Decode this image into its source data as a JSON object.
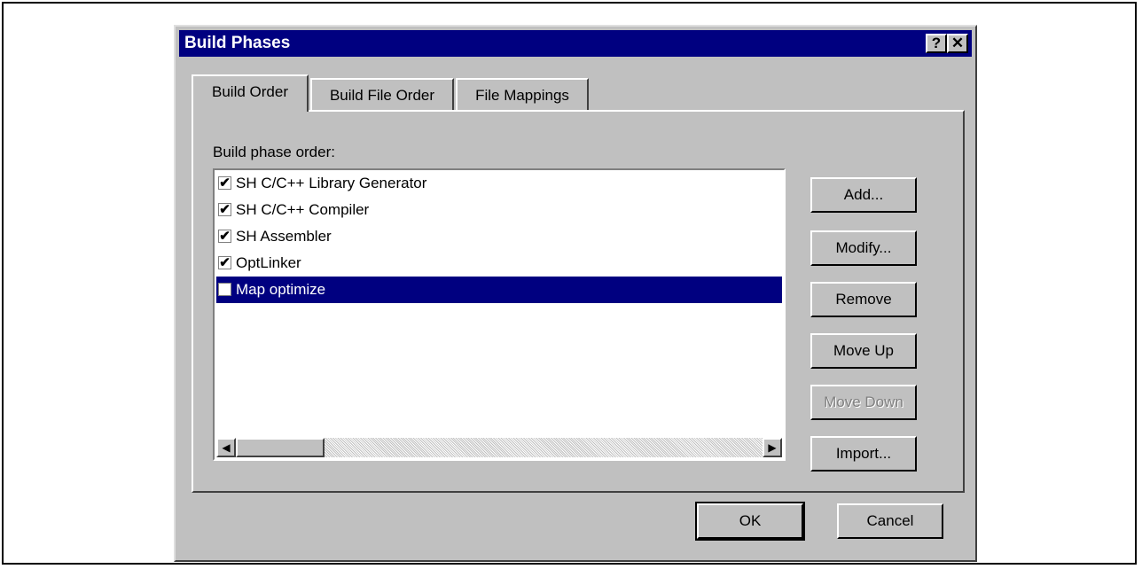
{
  "dialog": {
    "title": "Build Phases",
    "help_label": "?",
    "close_label": "✕"
  },
  "tabs": [
    {
      "label": "Build Order",
      "active": true
    },
    {
      "label": "Build File Order",
      "active": false
    },
    {
      "label": "File Mappings",
      "active": false
    }
  ],
  "panel": {
    "label": "Build phase order:",
    "phases": [
      {
        "label": "SH C/C++ Library Generator",
        "checked": true,
        "mark": "✔"
      },
      {
        "label": "SH C/C++ Compiler",
        "checked": true,
        "mark": "✔"
      },
      {
        "label": "SH Assembler",
        "checked": true,
        "mark": "✔"
      },
      {
        "label": "OptLinker",
        "checked": true,
        "mark": "✔"
      },
      {
        "label": "Map optimize",
        "checked": false,
        "selected": true,
        "mark": ""
      }
    ],
    "scroll_left": "◀",
    "scroll_right": "▶"
  },
  "side_buttons": {
    "add": "Add...",
    "modify": "Modify...",
    "remove": "Remove",
    "move_up": "Move Up",
    "move_down": "Move Down",
    "import": "Import..."
  },
  "footer": {
    "ok": "OK",
    "cancel": "Cancel"
  }
}
